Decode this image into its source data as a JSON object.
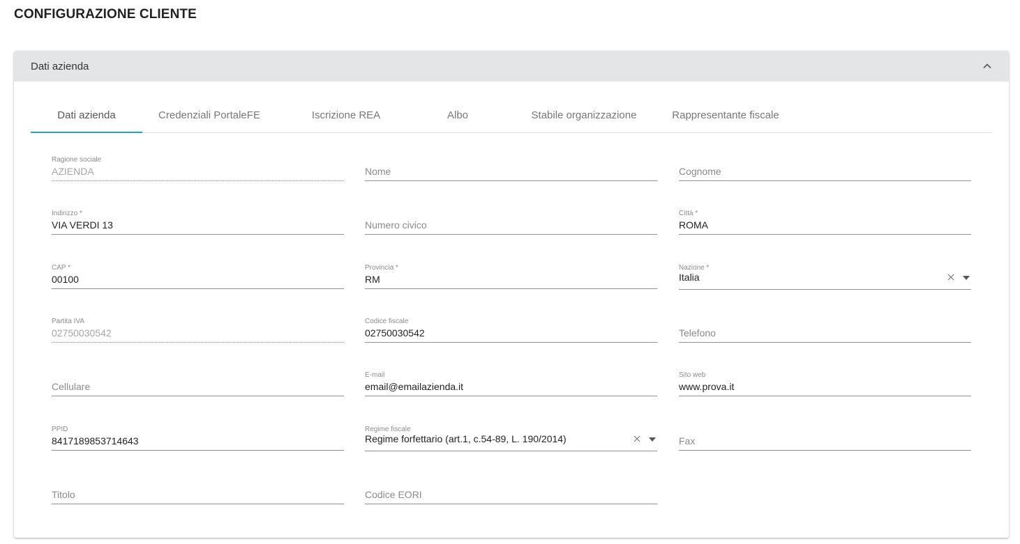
{
  "page": {
    "title": "CONFIGURAZIONE CLIENTE"
  },
  "panel": {
    "title": "Dati azienda"
  },
  "tabs": [
    {
      "label": "Dati azienda",
      "active": true
    },
    {
      "label": "Credenziali PortaleFE"
    },
    {
      "label": "Iscrizione REA"
    },
    {
      "label": "Albo"
    },
    {
      "label": "Stabile organizzazione"
    },
    {
      "label": "Rappresentante fiscale"
    }
  ],
  "fields": {
    "ragione_sociale": {
      "label": "Ragione sociale",
      "value": "AZIENDA",
      "disabled": true
    },
    "nome": {
      "placeholder": "Nome"
    },
    "cognome": {
      "placeholder": "Cognome"
    },
    "indirizzo": {
      "label": "Indirizzo *",
      "value": "VIA VERDI 13"
    },
    "numero_civico": {
      "placeholder": "Numero civico"
    },
    "citta": {
      "label": "Città *",
      "value": "ROMA"
    },
    "cap": {
      "label": "CAP *",
      "value": "00100"
    },
    "provincia": {
      "label": "Provincia *",
      "value": "RM"
    },
    "nazione": {
      "label": "Nazione *",
      "value": "Italia"
    },
    "partita_iva": {
      "label": "Partita IVA",
      "value": "02750030542",
      "disabled": true
    },
    "codice_fiscale": {
      "label": "Codice fiscale",
      "value": "02750030542"
    },
    "telefono": {
      "placeholder": "Telefono"
    },
    "cellulare": {
      "placeholder": "Cellulare"
    },
    "email": {
      "label": "E-mail",
      "value": "email@emailazienda.it"
    },
    "sito_web": {
      "label": "Sito web",
      "value": "www.prova.it"
    },
    "ppid": {
      "label": "PPID",
      "value": "8417189853714643"
    },
    "regime_fiscale": {
      "label": "Regime fiscale",
      "value": "Regime forfettario (art.1, c.54-89, L. 190/2014)"
    },
    "fax": {
      "placeholder": "Fax"
    },
    "titolo": {
      "placeholder": "Titolo"
    },
    "codice_eori": {
      "placeholder": "Codice EORI"
    }
  },
  "colors": {
    "accent": "#1fa8c4",
    "header_bg": "#e4e5e6"
  },
  "icons": {
    "collapse": "chevron-up-icon",
    "clear": "close-icon",
    "dropdown": "caret-down-icon"
  }
}
